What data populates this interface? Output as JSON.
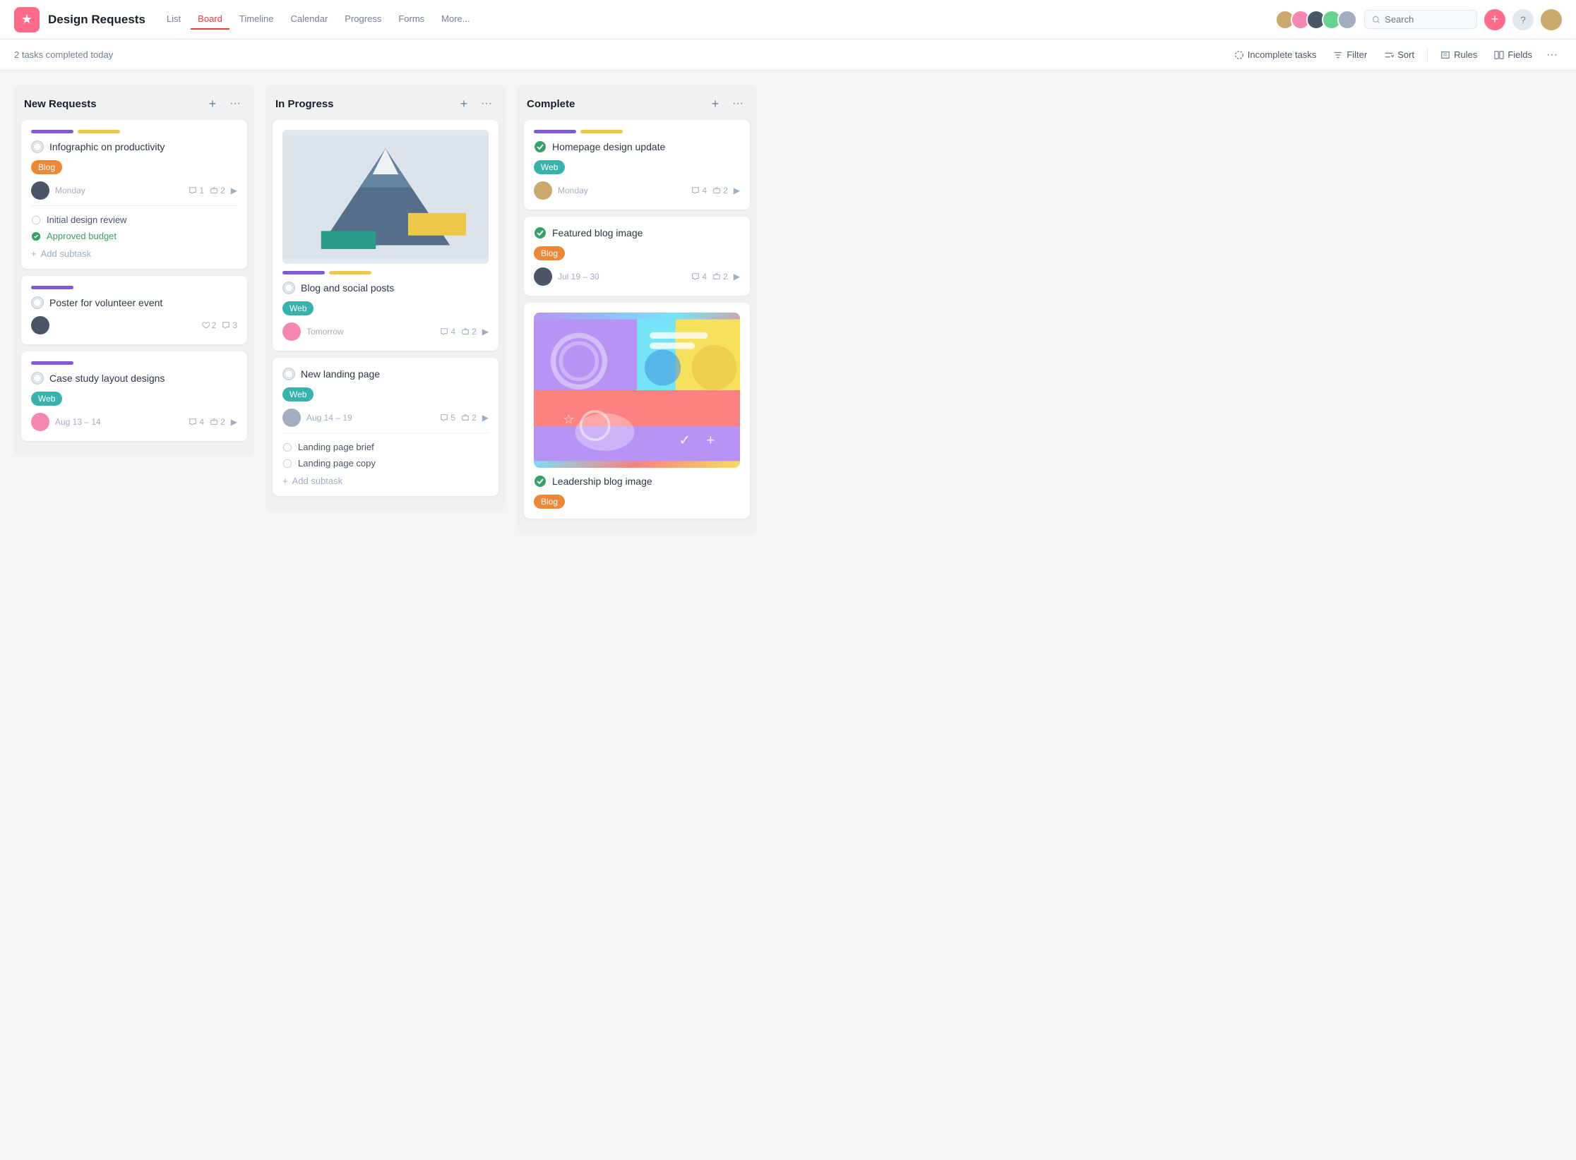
{
  "app": {
    "icon": "★",
    "title": "Design Requests",
    "icon_bg": "#ff6b8a"
  },
  "nav": {
    "tabs": [
      {
        "label": "List",
        "active": false
      },
      {
        "label": "Board",
        "active": true
      },
      {
        "label": "Timeline",
        "active": false
      },
      {
        "label": "Calendar",
        "active": false
      },
      {
        "label": "Progress",
        "active": false
      },
      {
        "label": "Forms",
        "active": false
      },
      {
        "label": "More...",
        "active": false
      }
    ]
  },
  "toolbar": {
    "tasks_completed": "2 tasks completed today",
    "incomplete_tasks": "Incomplete tasks",
    "filter": "Filter",
    "sort": "Sort",
    "rules": "Rules",
    "fields": "Fields"
  },
  "search": {
    "placeholder": "Search"
  },
  "columns": [
    {
      "id": "new-requests",
      "title": "New Requests",
      "cards": [
        {
          "id": "card-1",
          "tags": [
            "purple",
            "yellow"
          ],
          "title": "Infographic on productivity",
          "badge": "Blog",
          "badge_type": "orange",
          "assignee_type": "dark",
          "date": "Monday",
          "comments": "1",
          "subtasks": "2",
          "has_arrow": true,
          "subtask_items": [
            {
              "label": "Initial design review",
              "done": false
            },
            {
              "label": "Approved budget",
              "done": true
            }
          ],
          "add_subtask": "Add subtask"
        },
        {
          "id": "card-2",
          "tags": [
            "purple"
          ],
          "title": "Poster for volunteer event",
          "badge": null,
          "assignee_type": "dark",
          "date": null,
          "likes": "2",
          "comments": "3"
        },
        {
          "id": "card-3",
          "tags": [
            "purple"
          ],
          "title": "Case study layout designs",
          "badge": "Web",
          "badge_type": "teal",
          "assignee_type": "pink",
          "date": "Aug 13 – 14",
          "comments": "4",
          "subtasks": "2",
          "has_arrow": true
        }
      ]
    },
    {
      "id": "in-progress",
      "title": "In Progress",
      "cards": [
        {
          "id": "card-4",
          "has_image": true,
          "tags": [
            "purple",
            "yellow"
          ],
          "title": "Blog and social posts",
          "badge": "Web",
          "badge_type": "teal",
          "assignee_type": "pink",
          "date": "Tomorrow",
          "comments": "4",
          "subtasks": "2",
          "has_arrow": true
        },
        {
          "id": "card-5",
          "tags": [],
          "title": "New landing page",
          "badge": "Web",
          "badge_type": "teal",
          "assignee_type": "dark",
          "date": "Aug 14 – 19",
          "comments": "5",
          "subtasks": "2",
          "has_arrow": true,
          "subtask_items": [
            {
              "label": "Landing page brief",
              "done": false
            },
            {
              "label": "Landing page copy",
              "done": false
            }
          ],
          "add_subtask": "Add subtask"
        }
      ]
    },
    {
      "id": "complete",
      "title": "Complete",
      "cards": [
        {
          "id": "card-6",
          "tags": [
            "purple",
            "yellow"
          ],
          "title": "Homepage design update",
          "badge": "Web",
          "badge_type": "teal",
          "assignee_type": "light",
          "date": "Monday",
          "comments": "4",
          "subtasks": "2",
          "has_arrow": true,
          "done": true
        },
        {
          "id": "card-7",
          "tags": [],
          "title": "Featured blog image",
          "badge": "Blog",
          "badge_type": "orange",
          "assignee_type": "dark",
          "date": "Jul 19 – 30",
          "comments": "4",
          "subtasks": "2",
          "has_arrow": true,
          "done": true
        },
        {
          "id": "card-8",
          "has_design_image": true,
          "title": "Leadership blog image",
          "badge": "Blog",
          "badge_type": "orange",
          "done": true
        }
      ]
    }
  ]
}
